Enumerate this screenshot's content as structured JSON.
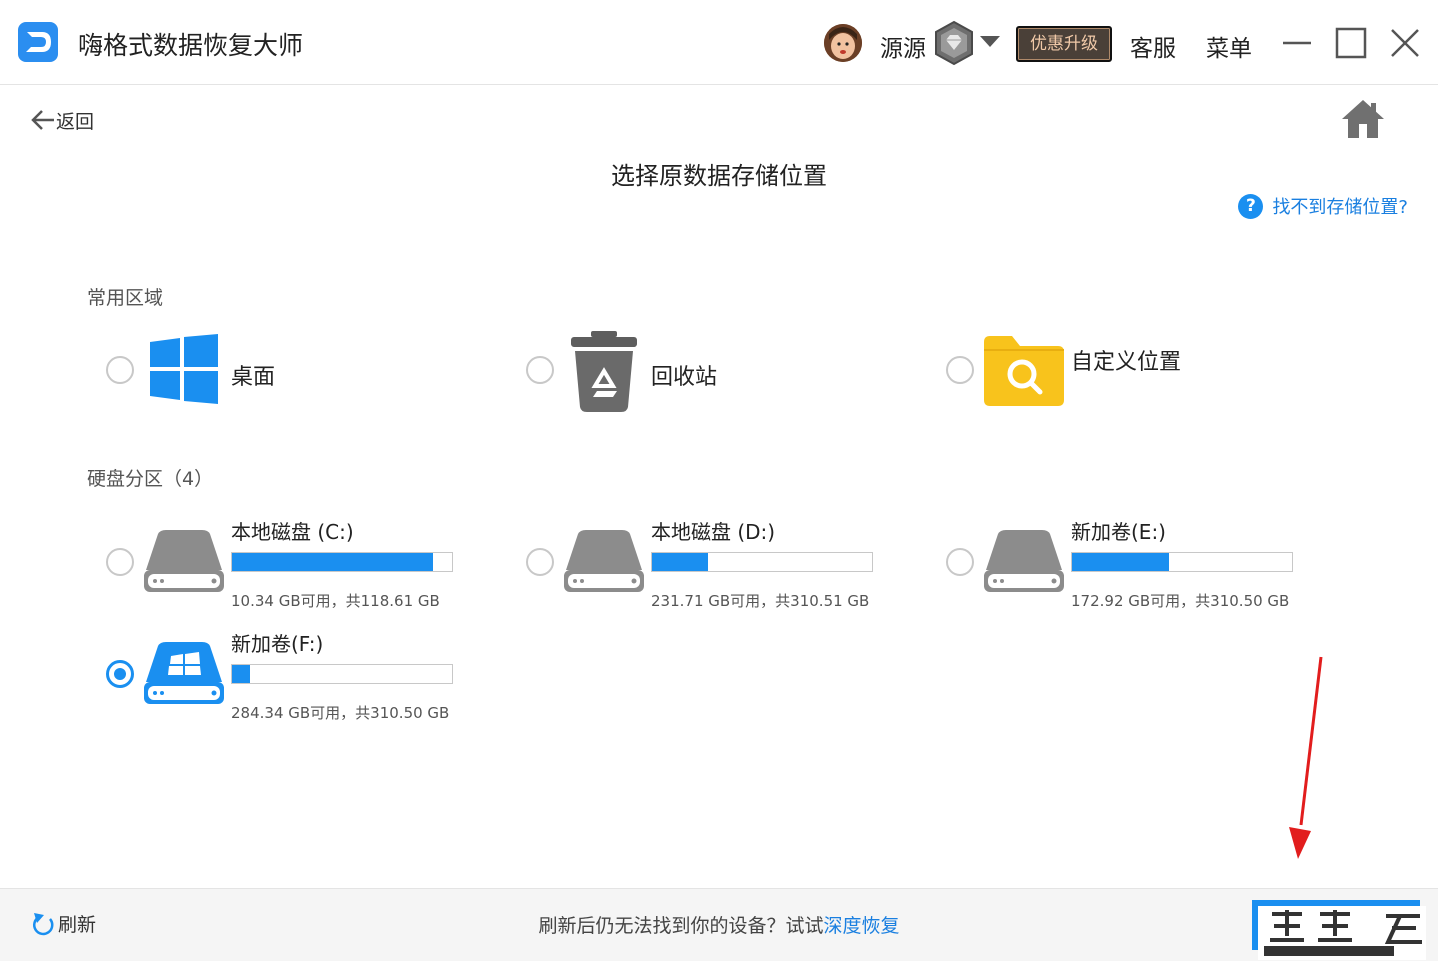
{
  "app": {
    "title": "嗨格式数据恢复大师"
  },
  "header": {
    "username": "源源",
    "upgrade_label": "优惠升级",
    "support_label": "客服",
    "menu_label": "菜单"
  },
  "nav": {
    "back_label": "返回"
  },
  "page": {
    "title": "选择原数据存储位置",
    "help_icon_text": "?",
    "help_link": "找不到存储位置?"
  },
  "common": {
    "section_label": "常用区域",
    "items": [
      {
        "label": "桌面",
        "icon": "windows-logo-icon",
        "selected": false
      },
      {
        "label": "回收站",
        "icon": "recycle-bin-icon",
        "selected": false
      },
      {
        "label": "自定义位置",
        "icon": "folder-search-icon",
        "selected": false
      }
    ]
  },
  "drives": {
    "section_label": "硬盘分区（4）",
    "items": [
      {
        "name": "本地磁盘 (C:)",
        "info": "10.34 GB可用，共118.61 GB",
        "used_fraction": 0.913,
        "selected": false
      },
      {
        "name": "本地磁盘 (D:)",
        "info": "231.71 GB可用，共310.51 GB",
        "used_fraction": 0.254,
        "selected": false
      },
      {
        "name": "新加卷(E:)",
        "info": "172.92 GB可用，共310.50 GB",
        "used_fraction": 0.443,
        "selected": false
      },
      {
        "name": "新加卷(F:)",
        "info": "284.34 GB可用，共310.50 GB",
        "used_fraction": 0.084,
        "selected": true
      }
    ]
  },
  "footer": {
    "refresh_label": "刷新",
    "hint_text": "刷新后仍无法找到你的设备？试试",
    "deep_recovery_link": "深度恢复"
  },
  "colors": {
    "accent": "#1a8ff0",
    "folder_yellow": "#f8c31c",
    "drive_gray": "#8c8c8c"
  }
}
